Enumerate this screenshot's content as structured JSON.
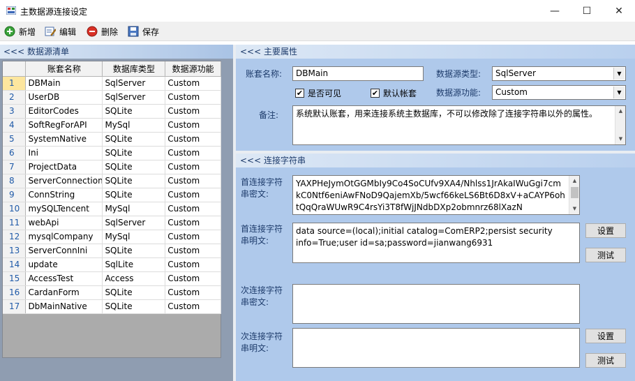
{
  "window": {
    "title": "主数据源连接设定",
    "minimize_glyph": "—",
    "maximize_glyph": "☐",
    "close_glyph": "✕"
  },
  "toolbar": {
    "add_label": "新增",
    "edit_label": "编辑",
    "delete_label": "删除",
    "save_label": "保存"
  },
  "left_panel": {
    "header": "<<< 数据源清单",
    "columns": [
      "账套名称",
      "数据库类型",
      "数据源功能"
    ],
    "rows": [
      {
        "num": "1",
        "name": "DBMain",
        "type": "SqlServer",
        "func": "Custom"
      },
      {
        "num": "2",
        "name": "UserDB",
        "type": "SqlServer",
        "func": "Custom"
      },
      {
        "num": "3",
        "name": "EditorCodes",
        "type": "SQLite",
        "func": "Custom"
      },
      {
        "num": "4",
        "name": "SoftRegForAPI",
        "type": "MySql",
        "func": "Custom"
      },
      {
        "num": "5",
        "name": "SystemNative",
        "type": "SQLite",
        "func": "Custom"
      },
      {
        "num": "6",
        "name": "Ini",
        "type": "SQLite",
        "func": "Custom"
      },
      {
        "num": "7",
        "name": "ProjectData",
        "type": "SQLite",
        "func": "Custom"
      },
      {
        "num": "8",
        "name": "ServerConnections",
        "type": "SQLite",
        "func": "Custom"
      },
      {
        "num": "9",
        "name": "ConnString",
        "type": "SQLite",
        "func": "Custom"
      },
      {
        "num": "10",
        "name": "mySQLTencent",
        "type": "MySql",
        "func": "Custom"
      },
      {
        "num": "11",
        "name": "webApi",
        "type": "SqlServer",
        "func": "Custom"
      },
      {
        "num": "12",
        "name": "mysqlCompany",
        "type": "MySql",
        "func": "Custom"
      },
      {
        "num": "13",
        "name": "ServerConnIni",
        "type": "SQLite",
        "func": "Custom"
      },
      {
        "num": "14",
        "name": "update",
        "type": "SqlLite",
        "func": "Custom"
      },
      {
        "num": "15",
        "name": "AccessTest",
        "type": "Access",
        "func": "Custom"
      },
      {
        "num": "16",
        "name": "CardanForm",
        "type": "SQLite",
        "func": "Custom"
      },
      {
        "num": "17",
        "name": "DbMainNative",
        "type": "SQLite",
        "func": "Custom"
      }
    ]
  },
  "properties": {
    "header": "<<< 主要属性",
    "account_label": "账套名称:",
    "account_value": "DBMain",
    "db_type_label": "数据源类型:",
    "db_type_value": "SqlServer",
    "visible_label": "是否可见",
    "visible_checked": "✔",
    "default_label": "默认帐套",
    "default_checked": "✔",
    "function_label": "数据源功能:",
    "function_value": "Custom",
    "remark_label": "备注:",
    "remark_value": "系统默认账套，用来连接系统主数据库，不可以修改除了连接字符串以外的属性。"
  },
  "connection": {
    "header": "<<< 连接字符串",
    "primary_cipher_label": "首连接字符串密文:",
    "primary_cipher_value": "YAXPHeJymOtGGMbIy9Co4SoCUfv9XA4/Nhlss1JrAkaIWuGgi7cmkC0Ntf6eniAwFNoD9QajemXb/5wcf66keLS6Bt6D8xV+aCAYP6ohtQqQraWUwR9C4rsYi3T8fWjJNdbDXp2obmnrz68lXazN",
    "primary_plain_label": "首连接字符串明文:",
    "primary_plain_value": "data source=(local);initial catalog=ComERP2;persist security info=True;user id=sa;password=jianwang6931",
    "secondary_cipher_label": "次连接字符串密文:",
    "secondary_cipher_value": "",
    "secondary_plain_label": "次连接字符串明文:",
    "secondary_plain_value": "",
    "set_label": "设置",
    "test_label": "测试"
  }
}
